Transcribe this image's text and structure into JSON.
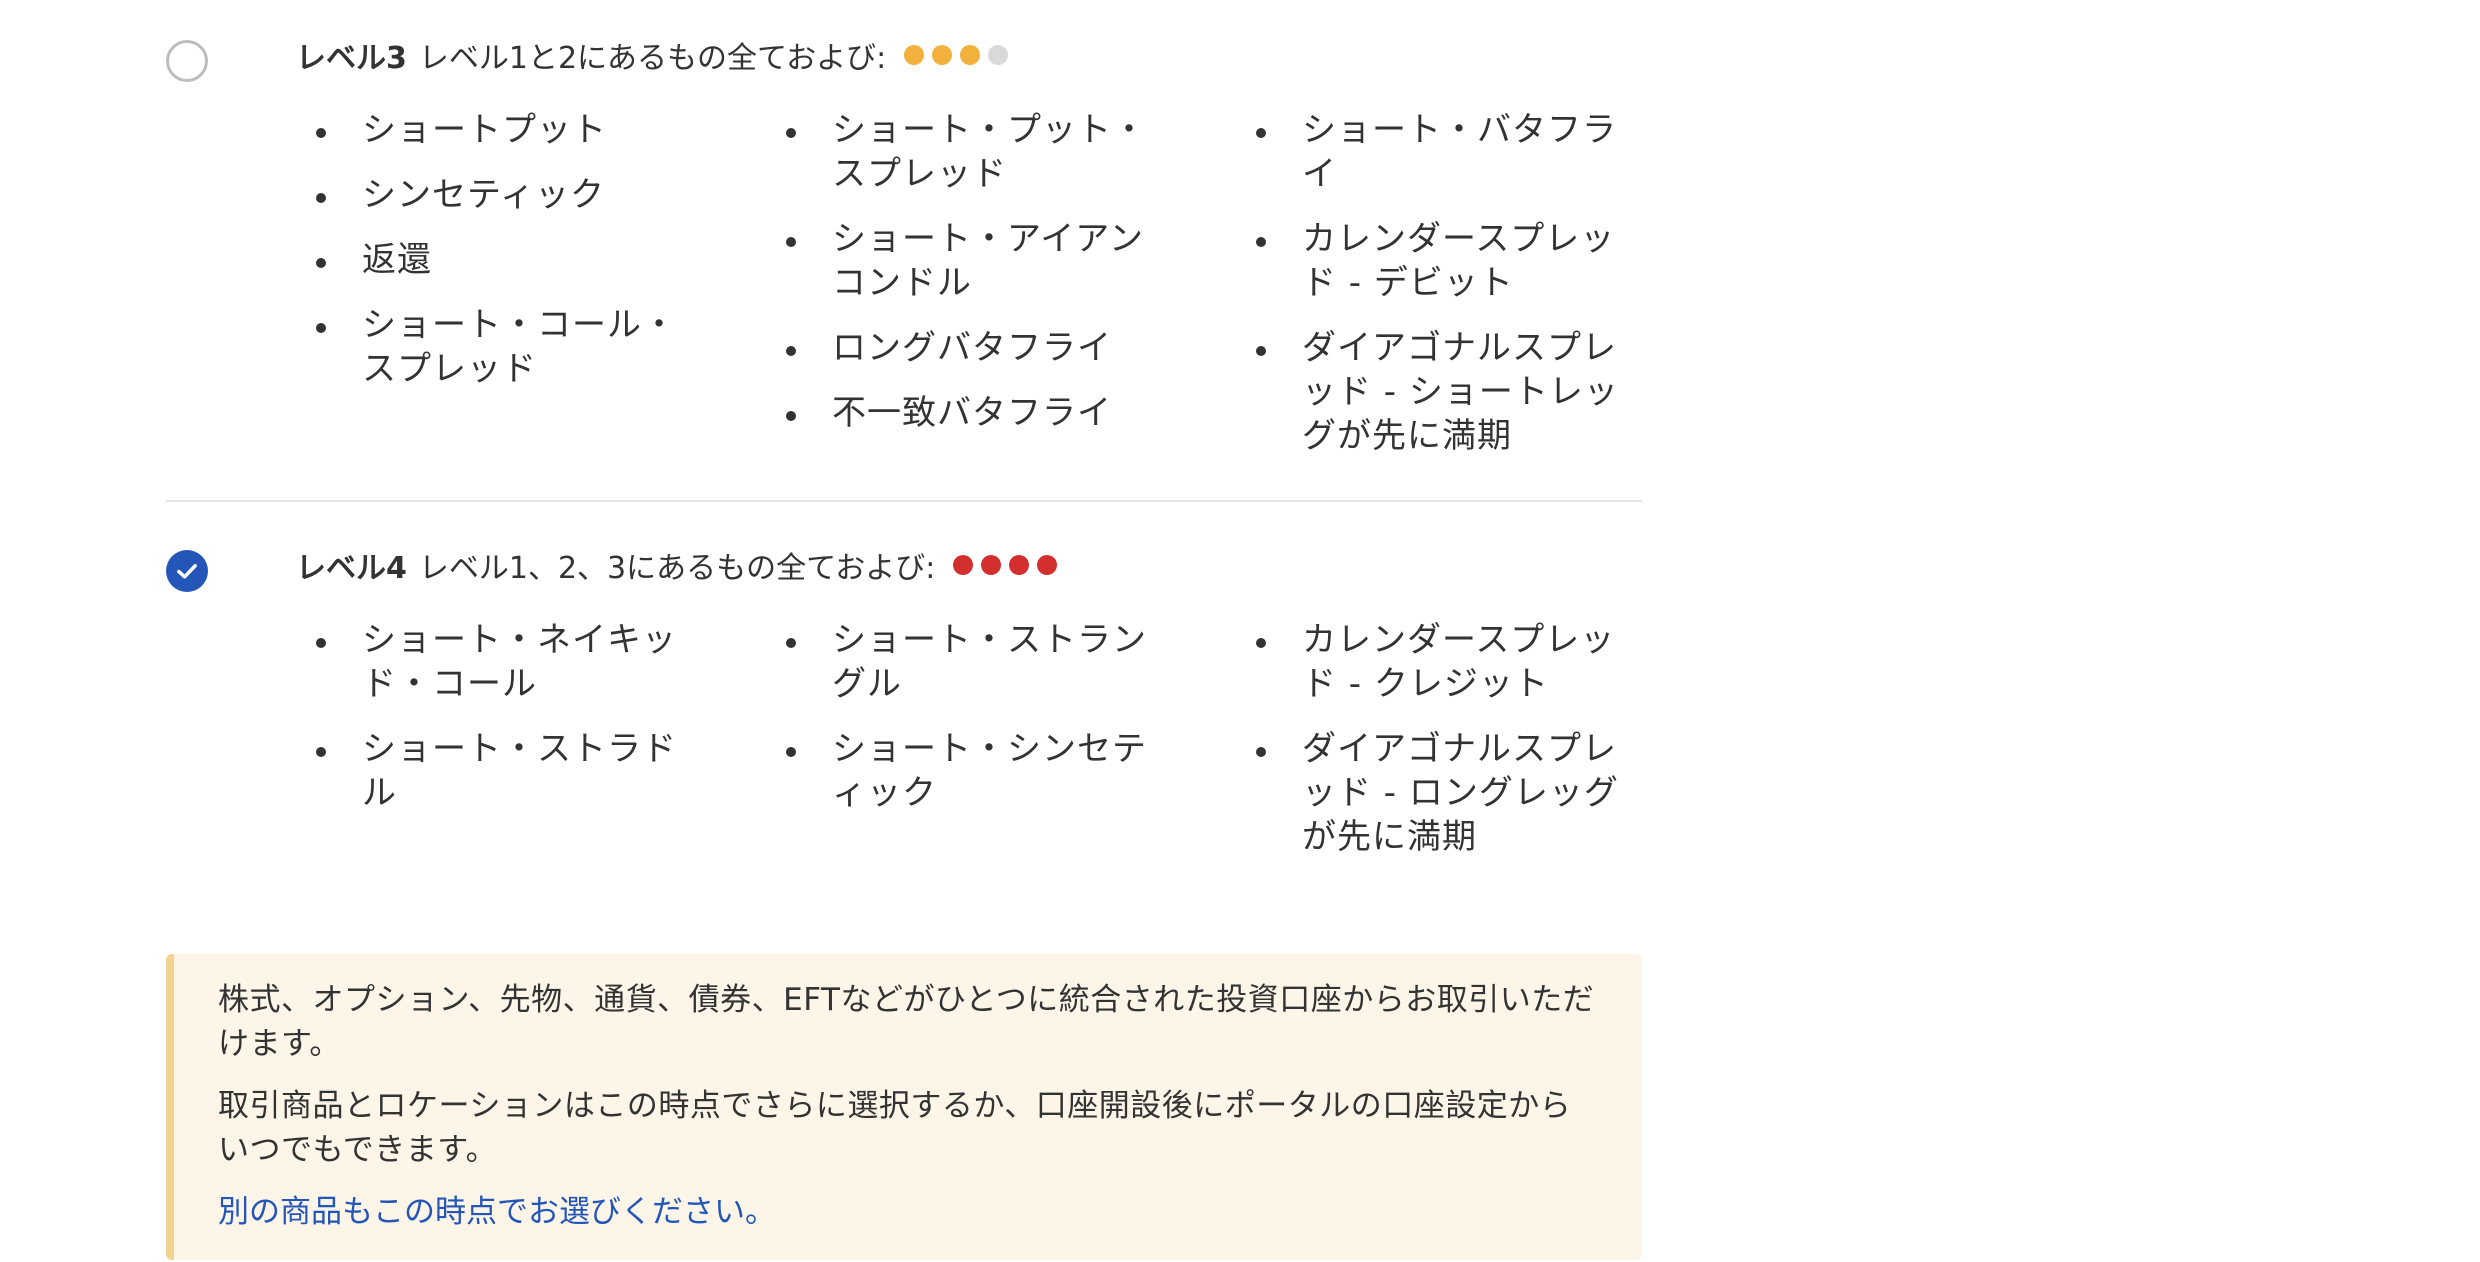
{
  "levels": [
    {
      "name": "レベル3",
      "description": "レベル1と2にあるもの全ておよび:",
      "selected": false,
      "dots": [
        "#f2b03c",
        "#f2b03c",
        "#f2b03c",
        "#d9d9d9"
      ],
      "columns": [
        [
          "ショートプット",
          "シンセティック",
          "返還",
          "ショート・コール・スプレッド"
        ],
        [
          "ショート・プット・スプレッド",
          "ショート・アイアンコンドル",
          "ロングバタフライ",
          "不一致バタフライ"
        ],
        [
          "ショート・バタフライ",
          "カレンダースプレッド - デビット",
          "ダイアゴナルスプレッド - ショートレッグが先に満期"
        ]
      ]
    },
    {
      "name": "レベル4",
      "description": "レベル1、2、3にあるもの全ておよび:",
      "selected": true,
      "dots": [
        "#d32f2f",
        "#d32f2f",
        "#d32f2f",
        "#d32f2f"
      ],
      "columns": [
        [
          "ショート・ネイキッド・コール",
          "ショート・ストラドル"
        ],
        [
          "ショート・ストラングル",
          "ショート・シンセティック"
        ],
        [
          "カレンダースプレッド - クレジット",
          "ダイアゴナルスプレッド - ロングレッグが先に満期"
        ]
      ]
    }
  ],
  "info": {
    "paragraph1": "株式、オプション、先物、通貨、債券、EFTなどがひとつに統合された投資口座からお取引いただけます。",
    "paragraph2": "取引商品とロケーションはこの時点でさらに選択するか、口座開設後にポータルの口座設定からいつでもできます。",
    "link": "別の商品もこの時点でお選びください。"
  },
  "colors": {
    "accent": "#2356b8",
    "info_bg": "#fcf5e8",
    "info_border": "#f2d28e"
  }
}
